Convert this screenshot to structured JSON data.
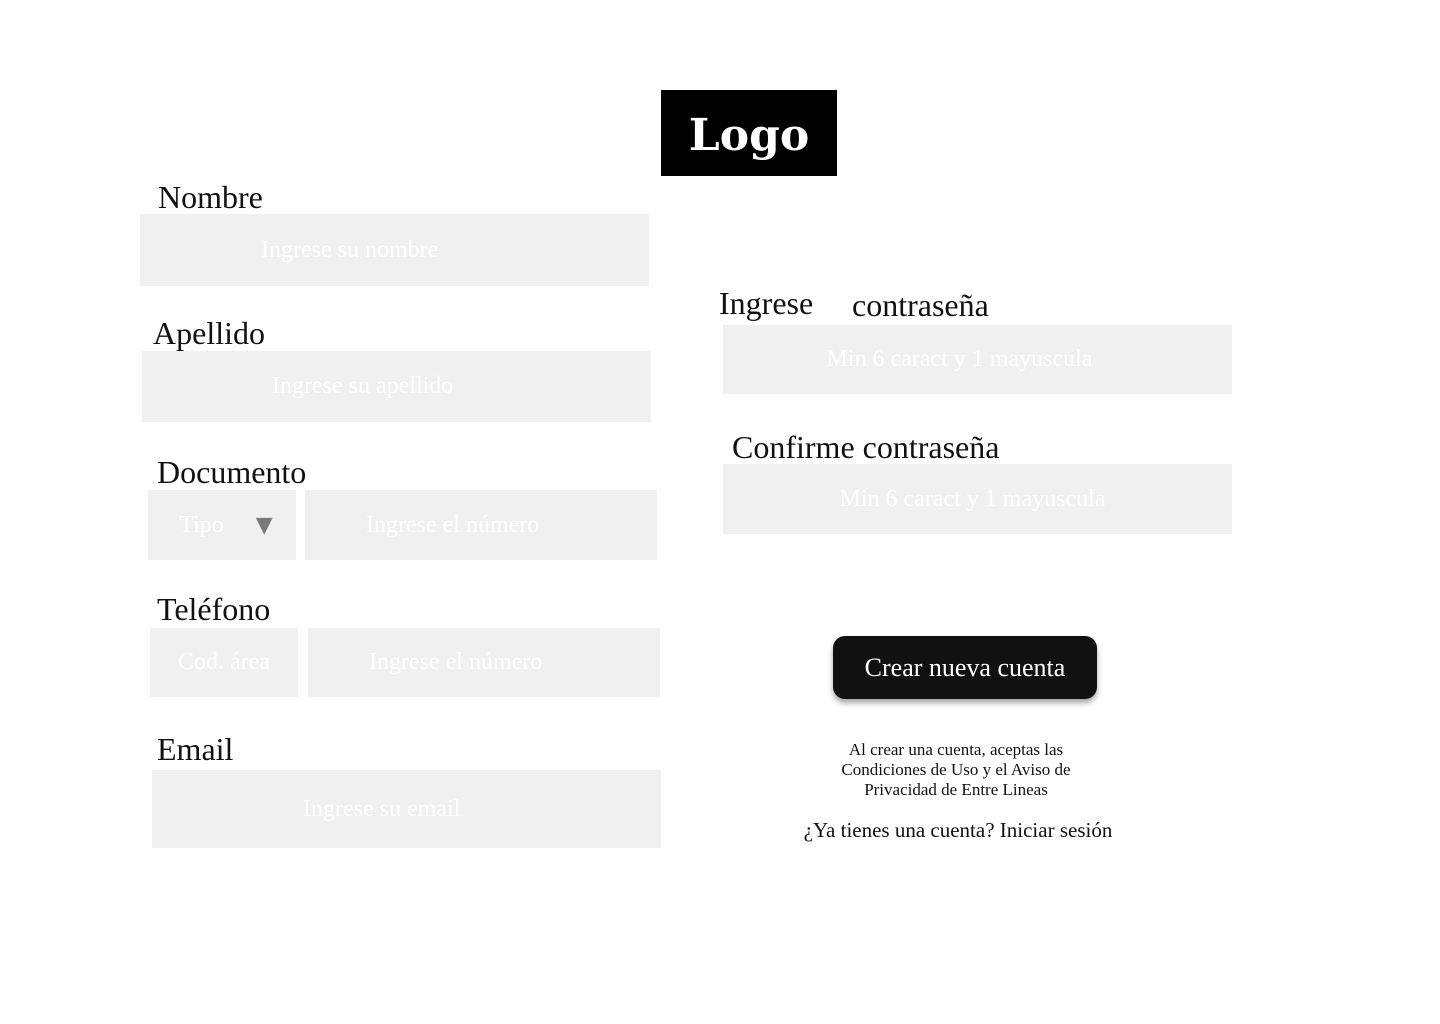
{
  "logo": {
    "text": "Logo"
  },
  "form": {
    "nombre": {
      "label": "Nombre",
      "placeholder": "Ingrese su nombre"
    },
    "apellido": {
      "label": "Apellido",
      "placeholder": "Ingrese su apellido"
    },
    "documento": {
      "label": "Documento",
      "type_placeholder": "Tipo",
      "type_arrow": "▼",
      "number_placeholder": "Ingrese el número"
    },
    "telefono": {
      "label": "Teléfono",
      "area_placeholder": "Cod. área",
      "number_placeholder": "Ingrese el número"
    },
    "email": {
      "label": "Email",
      "placeholder": "Ingrese su email"
    },
    "password": {
      "label_part1": "Ingrese",
      "label_part2": "contraseña",
      "placeholder": "Min 6 caract y 1 mayuscula"
    },
    "confirm_password": {
      "label": "Confirme contraseña",
      "placeholder": "Min 6 caract y 1 mayuscula"
    }
  },
  "actions": {
    "create_account": "Crear nueva cuenta",
    "terms_line1": "Al crear una cuenta, aceptas las",
    "terms_line2": "Condiciones de Uso y el Aviso de",
    "terms_line3": "Privacidad de Entre Lineas",
    "have_account": "¿Ya tienes una cuenta? Iniciar sesión"
  },
  "colors": {
    "field_bg": "#f0f0f0",
    "placeholder_text": "#ffffff",
    "button_bg": "#111111",
    "logo_bg": "#000000"
  }
}
